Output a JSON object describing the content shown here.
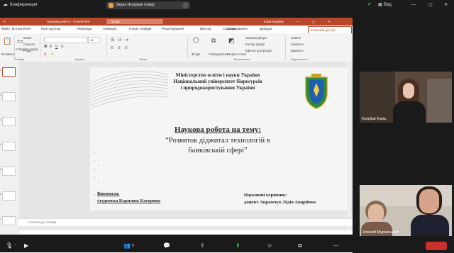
{
  "meeting": {
    "title": "Конференция",
    "view_label": "Вид"
  },
  "share": {
    "label": "Экран (Karpliuk Katia)"
  },
  "ppt": {
    "title": "Наукова робота - PowerPoint",
    "search": "Пошук",
    "user": "Katia Karpliuk",
    "tabs": [
      "Файл",
      "Вставлення",
      "Конструктор",
      "Переходи",
      "Анімація",
      "Показ слайдів",
      "Рецензування",
      "Вигляд",
      "Справка",
      "Записування",
      "Довідка"
    ],
    "share_button": "Спільний доступ",
    "ribbon": {
      "paste": "Вставити",
      "slides_group": "Слайди",
      "font_group": "Шрифт",
      "paragraph_group": "Абзац",
      "drawing_group": "Малювання",
      "editing_group": "Редагування",
      "new_slide": "Створити слайд",
      "layout": "Макет",
      "reset": "Скинути",
      "section": "Розділ",
      "shapes": "Фігури",
      "arrange": "Упорядкувати",
      "quick_styles": "Експрес-стилі",
      "shape_fill": "Заливка фігури",
      "shape_outline": "Контур фігури",
      "shape_effects": "Ефекти для фігури",
      "find": "Знайти",
      "replace": "Замінити",
      "select": "Виділити",
      "font_size": "18"
    },
    "notes_placeholder": "Нотатки до слайда",
    "status": {
      "notes": "Нотатки",
      "comments": "Примітки",
      "zoom": "44%"
    },
    "thumb_numbers": [
      "1",
      "2",
      "3",
      "4",
      "5",
      "6",
      "7"
    ]
  },
  "slide": {
    "line1": "Міністерство освіти і науки України",
    "line2": "Національний університет біоресурсів",
    "line3": "і природокористування України",
    "heading": "Наукова робота на тему:",
    "topic1": "“Розвиток діджитал технологій в",
    "topic2": "банківській сфері”",
    "performer_label": "Виконала:",
    "performer_name": "студентка Карплюк Катерина",
    "advisor_label": "Науковий керівник:",
    "advisor_name": "доцент Аврамчук Лідія Андріївна"
  },
  "participants": [
    {
      "name": "Karpliuk Katia"
    },
    {
      "name": "Олексій Муравський"
    }
  ],
  "toolbar": {
    "participants_count": "5",
    "icons": [
      "mic-icon",
      "video-icon",
      "participants-icon",
      "chat-icon",
      "share-screen-icon",
      "record-icon",
      "reactions-icon",
      "apps-icon",
      "more-icon"
    ]
  }
}
